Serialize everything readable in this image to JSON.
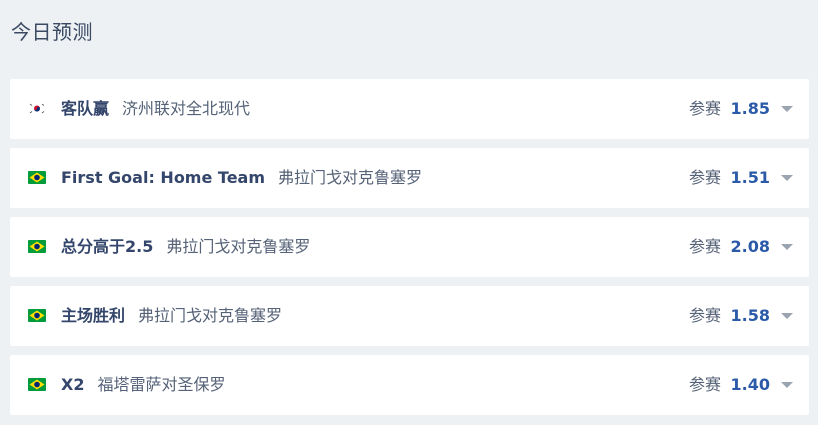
{
  "page_title": "今日预测",
  "bet_label": "参赛",
  "predictions": [
    {
      "flag": "south-korea-flag-icon",
      "market": "客队赢",
      "match": "济州联对全北现代",
      "odds": "1.85"
    },
    {
      "flag": "brazil-flag-icon",
      "market": "First Goal: Home Team",
      "match": "弗拉门戈对克鲁塞罗",
      "odds": "1.51"
    },
    {
      "flag": "brazil-flag-icon",
      "market": "总分高于2.5",
      "match": "弗拉门戈对克鲁塞罗",
      "odds": "2.08"
    },
    {
      "flag": "brazil-flag-icon",
      "market": "主场胜利",
      "match": "弗拉门戈对克鲁塞罗",
      "odds": "1.58"
    },
    {
      "flag": "brazil-flag-icon",
      "market": "X2",
      "match": "福塔雷萨对圣保罗",
      "odds": "1.40"
    }
  ],
  "colors": {
    "background": "#edf1f4",
    "card": "#ffffff",
    "accent": "#2b5ba8",
    "market_text": "#34466b",
    "muted_text": "#556277"
  }
}
